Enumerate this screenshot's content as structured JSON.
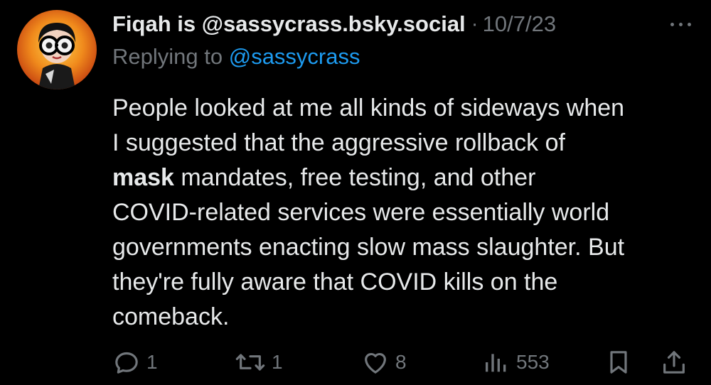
{
  "tweet": {
    "display_name": "Fiqah is @sassycrass.bsky.social",
    "separator": "·",
    "date": "10/7/23",
    "reply_prefix": "Replying to ",
    "reply_handle": "@sassycrass",
    "body_lines": [
      {
        "pre": "People looked at me all kinds of sideways when",
        "bold": "",
        "post": ""
      },
      {
        "pre": "I suggested that the aggressive rollback of",
        "bold": "",
        "post": ""
      },
      {
        "pre": "",
        "bold": "mask",
        "post": " mandates, free testing, and other"
      },
      {
        "pre": "COVID-related services were essentially world",
        "bold": "",
        "post": ""
      },
      {
        "pre": "governments enacting slow mass slaughter. But",
        "bold": "",
        "post": ""
      },
      {
        "pre": "they're fully aware that COVID kills on the",
        "bold": "",
        "post": ""
      },
      {
        "pre": "comeback.",
        "bold": "",
        "post": ""
      }
    ],
    "actions": {
      "replies": "1",
      "retweets": "1",
      "likes": "8",
      "views": "553"
    },
    "colors": {
      "background": "#000000",
      "text": "#e7e9ea",
      "muted": "#71767b",
      "link": "#1d9bf0"
    },
    "icons": {
      "reply": "reply-icon",
      "retweet": "retweet-icon",
      "like": "heart-icon",
      "views": "analytics-icon",
      "bookmark": "bookmark-icon",
      "share": "share-icon",
      "more": "more-icon"
    }
  }
}
